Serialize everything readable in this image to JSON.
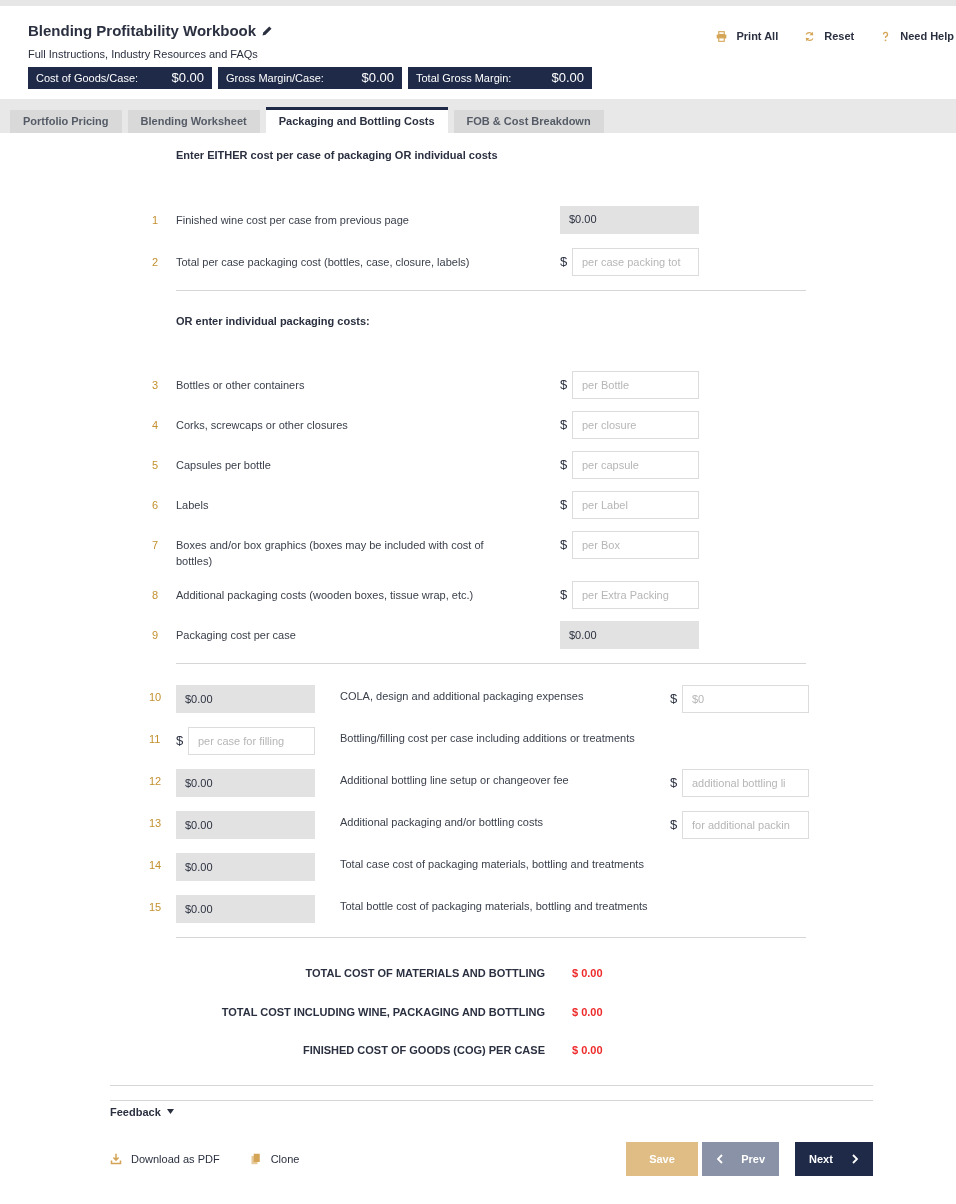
{
  "header": {
    "title": "Blending Profitability Workbook",
    "subtitle": "Full Instructions, Industry Resources and FAQs",
    "actions": [
      {
        "label": "Print All",
        "kind": "print"
      },
      {
        "label": "Reset",
        "kind": "reset"
      },
      {
        "label": "Need Help",
        "kind": "help"
      }
    ],
    "metrics": [
      {
        "label": "Cost of Goods/Case:",
        "value": "$0.00"
      },
      {
        "label": "Gross Margin/Case:",
        "value": "$0.00"
      },
      {
        "label": "Total Gross Margin:",
        "value": "$0.00"
      }
    ]
  },
  "tabs": [
    {
      "label": "Portfolio Pricing",
      "selected": false
    },
    {
      "label": "Blending Worksheet",
      "selected": false
    },
    {
      "label": "Packaging and Bottling Costs",
      "selected": true
    },
    {
      "label": "FOB & Cost Breakdown",
      "selected": false
    }
  ],
  "packaging": {
    "intro": "Enter EITHER cost per case of packaging OR individual costs",
    "case_rows": [
      {
        "number": "1",
        "label": "Finished wine cost per case from previous page",
        "field": {
          "kind": "readonly",
          "value": "$0.00"
        }
      },
      {
        "number": "2",
        "label": "Total per case packaging cost (bottles, case, closure, labels)",
        "field": {
          "kind": "input",
          "placeholder": "per case packing tot"
        }
      }
    ],
    "or_heading": "OR enter individual packaging costs:",
    "individual_rows": [
      {
        "number": "3",
        "label": "Bottles or other containers",
        "field": {
          "kind": "input",
          "placeholder": "per Bottle"
        }
      },
      {
        "number": "4",
        "label": "Corks, screwcaps or other closures",
        "field": {
          "kind": "input",
          "placeholder": "per closure"
        }
      },
      {
        "number": "5",
        "label": "Capsules per bottle",
        "field": {
          "kind": "input",
          "placeholder": "per capsule"
        }
      },
      {
        "number": "6",
        "label": "Labels",
        "field": {
          "kind": "input",
          "placeholder": "per Label"
        }
      },
      {
        "number": "7",
        "label": "Boxes and/or box graphics (boxes may be included with cost of bottles)",
        "field": {
          "kind": "input",
          "placeholder": "per Box"
        }
      },
      {
        "number": "8",
        "label": "Additional packaging costs (wooden boxes, tissue wrap, etc.)",
        "field": {
          "kind": "input",
          "placeholder": "per Extra Packing"
        }
      },
      {
        "number": "9",
        "label": "Packaging cost per case",
        "field": {
          "kind": "readonly",
          "value": "$0.00"
        }
      }
    ]
  },
  "bottling_rows": [
    {
      "number": "10",
      "left": {
        "kind": "readonly",
        "value": "$0.00"
      },
      "label": "COLA, design and additional packaging expenses",
      "right": {
        "placeholder": "$0"
      }
    },
    {
      "number": "11",
      "left": {
        "kind": "input",
        "placeholder": "per case for filling"
      },
      "label": "Bottling/filling cost per case including additions or treatments"
    },
    {
      "number": "12",
      "left": {
        "kind": "readonly",
        "value": "$0.00"
      },
      "label": "Additional bottling line setup or changeover fee",
      "right": {
        "placeholder": "additional bottling li"
      }
    },
    {
      "number": "13",
      "left": {
        "kind": "readonly",
        "value": "$0.00"
      },
      "label": "Additional packaging and/or bottling costs",
      "right": {
        "placeholder": "for additional packin"
      }
    },
    {
      "number": "14",
      "left": {
        "kind": "readonly",
        "value": "$0.00"
      },
      "label": "Total case cost of packaging materials, bottling and treatments"
    },
    {
      "number": "15",
      "left": {
        "kind": "readonly",
        "value": "$0.00"
      },
      "label": "Total bottle cost of packaging materials, bottling and treatments"
    }
  ],
  "currency_symbol": "$",
  "totals": [
    {
      "label": "TOTAL COST OF MATERIALS AND BOTTLING",
      "value": "$ 0.00"
    },
    {
      "label": "TOTAL COST INCLUDING WINE, PACKAGING AND BOTTLING",
      "value": "$ 0.00"
    },
    {
      "label": "FINISHED COST OF GOODS (COG) PER CASE",
      "value": "$ 0.00"
    }
  ],
  "feedback": {
    "label": "Feedback",
    "expanded": false
  },
  "footer": {
    "links": [
      {
        "label": "Download as PDF",
        "kind": "download"
      },
      {
        "label": "Clone",
        "kind": "clone"
      }
    ],
    "buttons": [
      {
        "label": "Save",
        "kind": "save"
      },
      {
        "label": "Prev",
        "kind": "prev"
      },
      {
        "label": "Next",
        "kind": "next"
      }
    ]
  }
}
